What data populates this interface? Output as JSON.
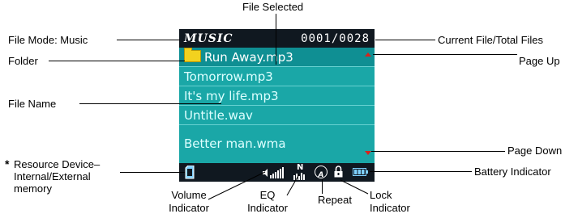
{
  "labels": {
    "file_selected": "File Selected",
    "file_mode": "File Mode: Music",
    "current_total": "Current File/Total Files",
    "folder": "Folder",
    "page_up": "Page Up",
    "file_name": "File Name",
    "page_down": "Page Down",
    "resource_star": "*",
    "resource_l1": "Resource Device–",
    "resource_l2": "Internal/External",
    "resource_l3": "memory",
    "battery": "Battery Indicator",
    "volume_l1": "Volume",
    "volume_l2": "Indicator",
    "eq_l1": "EQ",
    "eq_l2": "Indicator",
    "repeat": "Repeat",
    "lock_l1": "Lock",
    "lock_l2": "Indicator"
  },
  "screen": {
    "mode_text": "MUSIC",
    "counter": "0001/0028",
    "files": [
      "Run Away.mp3",
      "Tomorrow.mp3",
      "It's my life.mp3",
      "Untitle.wav",
      "Better man.wma"
    ],
    "eq_glyph": "N",
    "repeat_glyph": "A"
  },
  "colors": {
    "screen_bg": "#1aa7a7",
    "selected_row": "#0f8f93",
    "bar_bg": "#101820",
    "arrow": "#d8231c",
    "folder": "#f2d21f",
    "battery": "#7fd0ff"
  },
  "icons": [
    "folder-icon",
    "page-up-arrow-icon",
    "page-down-arrow-icon",
    "memory-card-icon",
    "volume-icon",
    "eq-icon",
    "repeat-icon",
    "lock-icon",
    "battery-icon"
  ]
}
